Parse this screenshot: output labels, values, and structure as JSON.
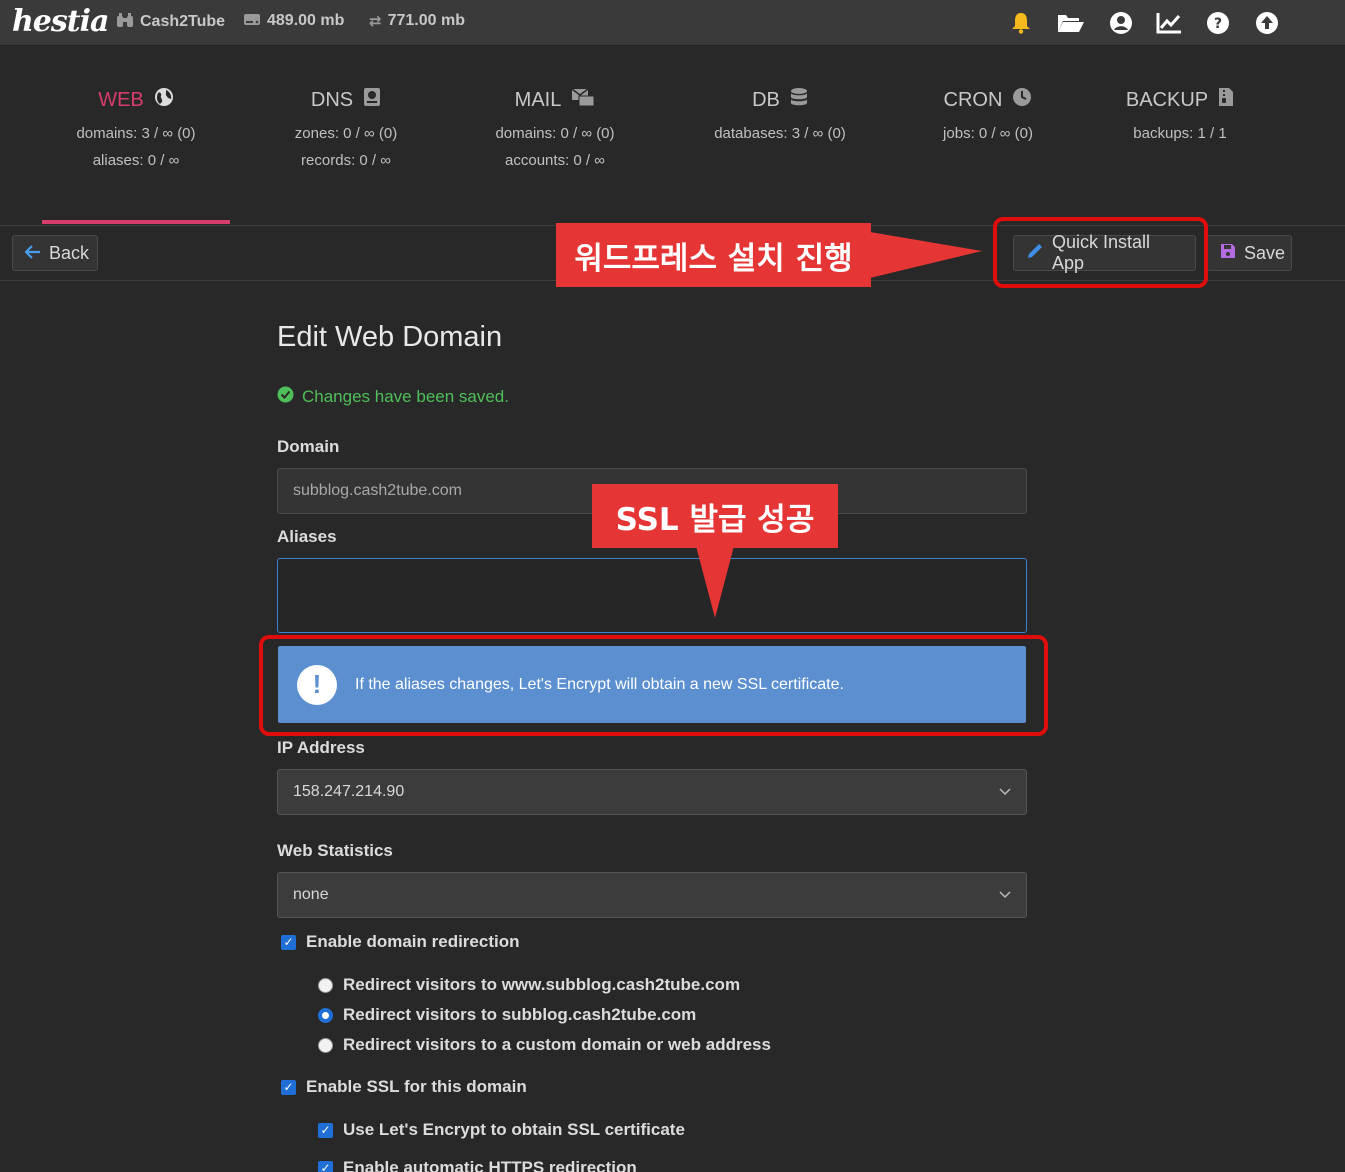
{
  "topbar": {
    "logo": "hestia",
    "user": "Cash2Tube",
    "disk": "489.00 mb",
    "bandwidth": "771.00 mb",
    "icons": [
      "bell-icon",
      "folder-icon",
      "user-icon",
      "chart-icon",
      "help-icon",
      "upload-icon"
    ]
  },
  "stats": [
    {
      "name": "WEB",
      "icon": "globe-icon",
      "lines": [
        "domains: 3 / ∞ (0)",
        "aliases: 0 / ∞"
      ],
      "active": true
    },
    {
      "name": "DNS",
      "icon": "book-icon",
      "lines": [
        "zones: 0 / ∞ (0)",
        "records: 0 / ∞"
      ]
    },
    {
      "name": "MAIL",
      "icon": "mail-icon",
      "lines": [
        "domains: 0 / ∞ (0)",
        "accounts: 0 / ∞"
      ]
    },
    {
      "name": "DB",
      "icon": "database-icon",
      "lines": [
        "databases: 3 / ∞ (0)"
      ]
    },
    {
      "name": "CRON",
      "icon": "clock-icon",
      "lines": [
        "jobs: 0 / ∞ (0)"
      ]
    },
    {
      "name": "BACKUP",
      "icon": "file-archive-icon",
      "lines": [
        "backups: 1 / 1"
      ]
    }
  ],
  "toolbar": {
    "back_label": "Back",
    "quick_install_label": "Quick Install App",
    "save_label": "Save"
  },
  "annotations": {
    "top_callout": "워드프레스 설치 진행",
    "ssl_callout": "SSL 발급 성공"
  },
  "form": {
    "title": "Edit Web Domain",
    "saved_message": "Changes have been saved.",
    "domain_label": "Domain",
    "domain_value": "subblog.cash2tube.com",
    "aliases_label": "Aliases",
    "aliases_value": "",
    "info_message": "If the aliases changes, Let's Encrypt will obtain a new SSL certificate.",
    "ip_label": "IP Address",
    "ip_value": "158.247.214.90",
    "stats_label": "Web Statistics",
    "stats_value": "none",
    "redirect_label": "Enable domain redirection",
    "redirect_options": [
      "Redirect visitors to www.subblog.cash2tube.com",
      "Redirect visitors to subblog.cash2tube.com",
      "Redirect visitors to a custom domain or web address"
    ],
    "redirect_selected": 1,
    "ssl_label": "Enable SSL for this domain",
    "letsencrypt_label": "Use Let's Encrypt to obtain SSL certificate",
    "https_redirect_label": "Enable automatic HTTPS redirection"
  }
}
